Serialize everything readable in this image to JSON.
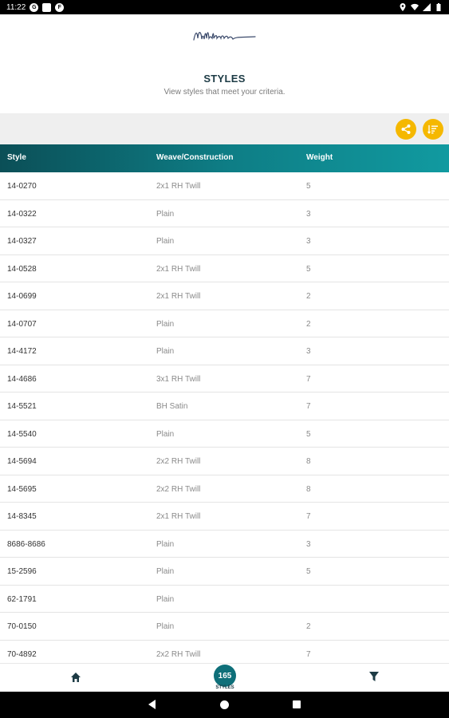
{
  "status_bar": {
    "time": "11:22",
    "notif_icons": [
      "G",
      "G",
      "F"
    ]
  },
  "header": {
    "logo_text": "Milliken",
    "title": "STYLES",
    "subtitle": "View styles that meet your criteria."
  },
  "table": {
    "columns": [
      "Style",
      "Weave/Construction",
      "Weight"
    ],
    "rows": [
      {
        "style": "14-0270",
        "weave": "2x1 RH Twill",
        "weight": "5"
      },
      {
        "style": "14-0322",
        "weave": "Plain",
        "weight": "3"
      },
      {
        "style": "14-0327",
        "weave": "Plain",
        "weight": "3"
      },
      {
        "style": "14-0528",
        "weave": "2x1 RH Twill",
        "weight": "5"
      },
      {
        "style": "14-0699",
        "weave": "2x1 RH Twill",
        "weight": "2"
      },
      {
        "style": "14-0707",
        "weave": "Plain",
        "weight": "2"
      },
      {
        "style": "14-4172",
        "weave": "Plain",
        "weight": "3"
      },
      {
        "style": "14-4686",
        "weave": "3x1 RH Twill",
        "weight": "7"
      },
      {
        "style": "14-5521",
        "weave": "BH Satin",
        "weight": "7"
      },
      {
        "style": "14-5540",
        "weave": "Plain",
        "weight": "5"
      },
      {
        "style": "14-5694",
        "weave": "2x2 RH Twill",
        "weight": "8"
      },
      {
        "style": "14-5695",
        "weave": "2x2 RH Twill",
        "weight": "8"
      },
      {
        "style": "14-8345",
        "weave": "2x1 RH Twill",
        "weight": "7"
      },
      {
        "style": "8686-8686",
        "weave": "Plain",
        "weight": "3"
      },
      {
        "style": "15-2596",
        "weave": "Plain",
        "weight": "5"
      },
      {
        "style": "62-1791",
        "weave": "Plain",
        "weight": ""
      },
      {
        "style": "70-0150",
        "weave": "Plain",
        "weight": "2"
      },
      {
        "style": "70-4892",
        "weave": "2x2 RH Twill",
        "weight": "7"
      }
    ]
  },
  "bottom_nav": {
    "count": "165",
    "count_label": "STYLES"
  },
  "icons": {
    "share": "share-icon",
    "sort": "sort-icon",
    "home": "home-icon",
    "filter": "filter-icon"
  },
  "colors": {
    "accent": "#f5b800",
    "header_teal": "#0e7d85",
    "badge": "#0e6f79"
  }
}
